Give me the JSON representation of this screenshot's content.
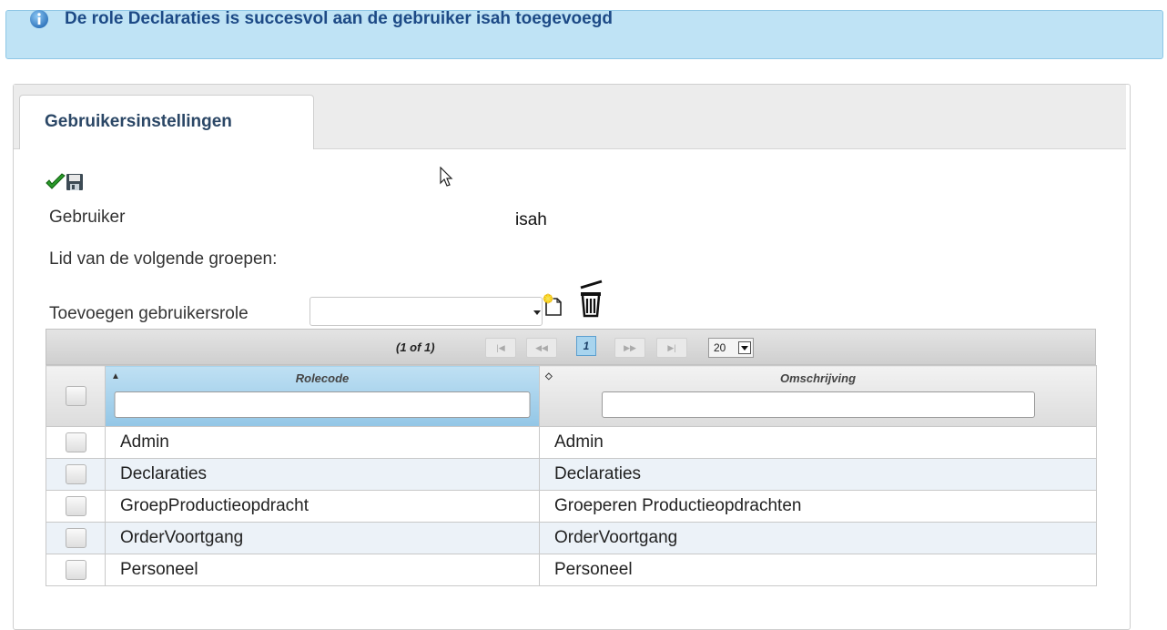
{
  "message": {
    "icon": "info-icon",
    "text": "De role Declaraties is succesvol aan de gebruiker isah toegevoegd",
    "background": "#bfe3f5",
    "text_color": "#1d4a86"
  },
  "tabs": [
    {
      "label": "Gebruikersinstellingen",
      "active": true
    }
  ],
  "toolbar": {
    "icons": [
      "checkmark-icon",
      "save-icon"
    ]
  },
  "form": {
    "user_label": "Gebruiker",
    "user_value": "isah",
    "groups_label": "Lid van de volgende groepen:",
    "add_role_label": "Toevoegen gebruikersrole",
    "add_role_value": "",
    "add_icon": "new-document-icon",
    "delete_icon": "trash-icon"
  },
  "grid": {
    "paginator": {
      "count": "(1 of 1)",
      "first": "|◀",
      "prev": "◀◀",
      "page": "1",
      "next": "▶▶",
      "last": "▶|",
      "rows_per_page": "20"
    },
    "columns": [
      {
        "label": "Rolecode",
        "sort": "ascending"
      },
      {
        "label": "Omschrijving",
        "sort": "sortable"
      }
    ],
    "rows": [
      {
        "rolecode": "Admin",
        "omschrijving": "Admin"
      },
      {
        "rolecode": "Declaraties",
        "omschrijving": "Declaraties"
      },
      {
        "rolecode": "GroepProductieopdracht",
        "omschrijving": "Groeperen Productieopdrachten"
      },
      {
        "rolecode": "OrderVoortgang",
        "omschrijving": "OrderVoortgang"
      },
      {
        "rolecode": "Personeel",
        "omschrijving": "Personeel"
      }
    ]
  },
  "colors": {
    "selected_header": "#93c6e6",
    "alt_row": "#ecf2f8",
    "check_green": "#2a9a2a"
  }
}
